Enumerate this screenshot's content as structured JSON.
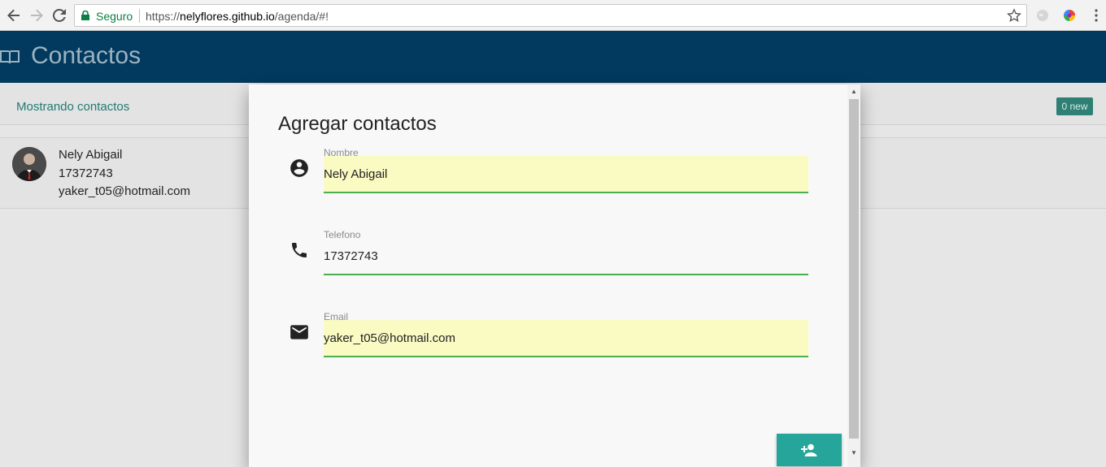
{
  "browser": {
    "secure_label": "Seguro",
    "url_scheme": "https://",
    "url_host": "nelyflores.github.io",
    "url_path": "/agenda/#!"
  },
  "app": {
    "title": "Contactos",
    "brand_color": "#013a5e",
    "accent_color": "#26a69a"
  },
  "list": {
    "status_text": "Mostrando contactos",
    "badge": "0 new",
    "contacts": [
      {
        "name": "Nely Abigail",
        "phone": "17372743",
        "email": "yaker_t05@hotmail.com"
      }
    ]
  },
  "modal": {
    "title": "Agregar contactos",
    "fields": [
      {
        "label": "Nombre",
        "value": "Nely Abigail",
        "icon": "account-circle-icon"
      },
      {
        "label": "Telefono",
        "value": "17372743",
        "icon": "phone-icon"
      },
      {
        "label": "Email",
        "value": "yaker_t05@hotmail.com",
        "icon": "email-icon"
      }
    ],
    "submit_icon": "person-add-icon"
  }
}
